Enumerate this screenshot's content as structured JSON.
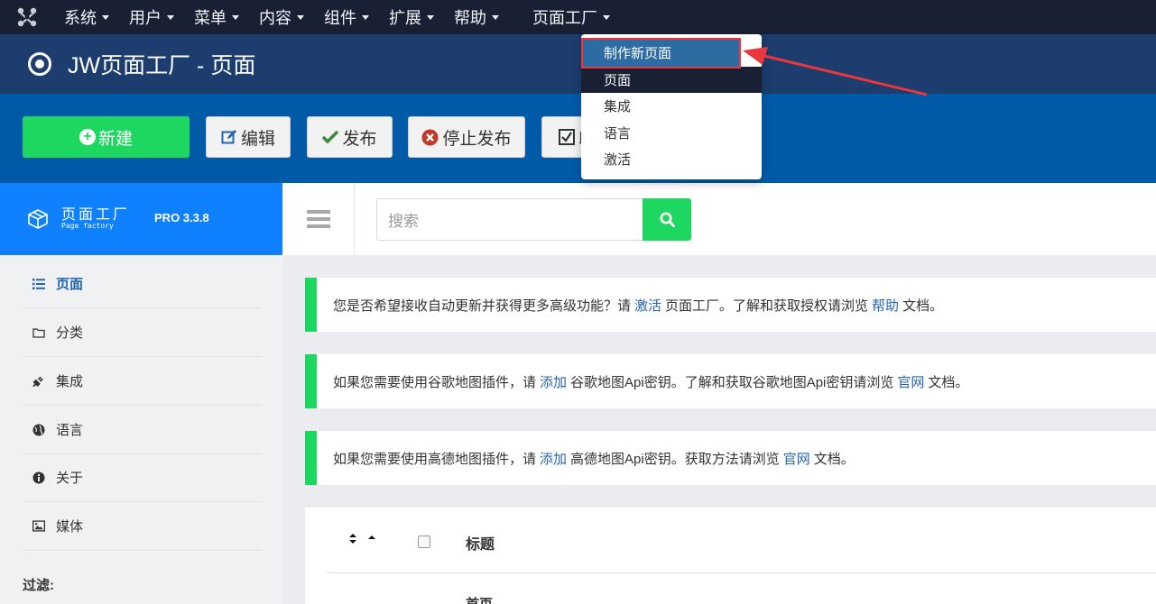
{
  "topnav": {
    "items": [
      {
        "label": "系统"
      },
      {
        "label": "用户"
      },
      {
        "label": "菜单"
      },
      {
        "label": "内容"
      },
      {
        "label": "组件"
      },
      {
        "label": "扩展"
      },
      {
        "label": "帮助"
      },
      {
        "label": "页面工厂"
      }
    ]
  },
  "dropdown": {
    "items": [
      {
        "label": "制作新页面"
      },
      {
        "label": "页面"
      },
      {
        "label": "集成"
      },
      {
        "label": "语言"
      },
      {
        "label": "激活"
      }
    ]
  },
  "page": {
    "title": "JW页面工厂 - 页面"
  },
  "toolbar": {
    "new_label": "新建",
    "edit_label": "编辑",
    "publish_label": "发布",
    "unpublish_label": "停止发布",
    "partial_label": "印"
  },
  "sidebar": {
    "brand_cn": "页面工厂",
    "brand_en": "Page factory",
    "version": "PRO 3.3.8",
    "items": [
      {
        "label": "页面"
      },
      {
        "label": "分类"
      },
      {
        "label": "集成"
      },
      {
        "label": "语言"
      },
      {
        "label": "关于"
      },
      {
        "label": "媒体"
      }
    ],
    "filter_label": "过滤:"
  },
  "search": {
    "placeholder": "搜索"
  },
  "notices": [
    {
      "pre": "您是否希望接收自动更新并获得更多高级功能？请",
      "link1": "激活",
      "mid": "页面工厂。了解和获取授权请浏览",
      "link2": "帮助",
      "post": "文档。"
    },
    {
      "pre": "如果您需要使用谷歌地图插件，请",
      "link1": "添加",
      "mid": "谷歌地图Api密钥。了解和获取谷歌地图Api密钥请浏览",
      "link2": "官网",
      "post": "文档。"
    },
    {
      "pre": "如果您需要使用高德地图插件，请",
      "link1": "添加",
      "mid": "高德地图Api密钥。获取方法请浏览",
      "link2": "官网",
      "post": "文档。"
    }
  ],
  "table": {
    "header_title": "标题",
    "first_row": "首页"
  },
  "colors": {
    "nav_bg": "#1a2033",
    "title_bg": "#1c3d6e",
    "toolbar_bg": "#005aa8",
    "sidebar_header_bg": "#0f81ff",
    "green": "#1ed760",
    "link": "#2764b0",
    "annotation_red": "#e8383d"
  }
}
